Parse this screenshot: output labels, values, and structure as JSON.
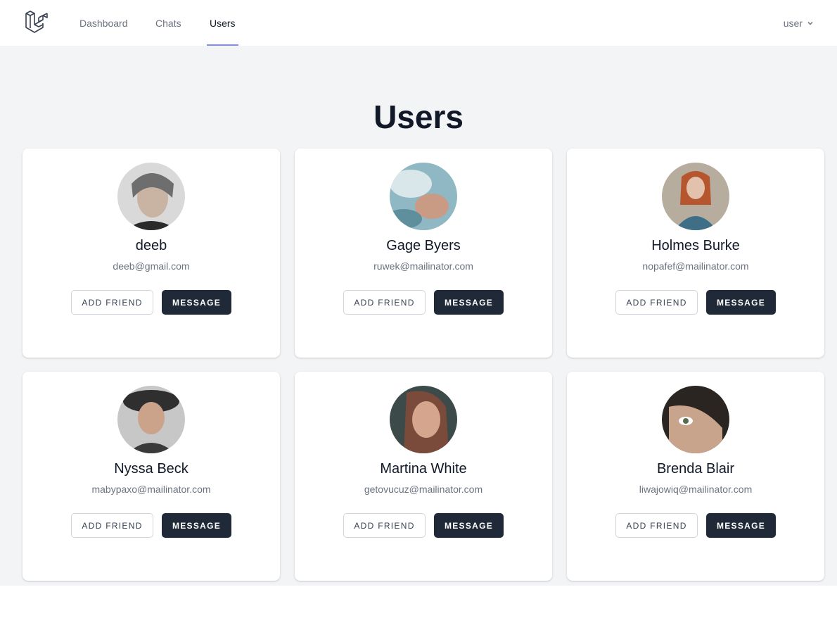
{
  "nav": {
    "links": [
      {
        "label": "Dashboard"
      },
      {
        "label": "Chats"
      },
      {
        "label": "Users",
        "active": true
      }
    ],
    "user_label": "user",
    "user_icon": "chevron-down-icon"
  },
  "page": {
    "title": "Users"
  },
  "users": [
    {
      "name": "deeb",
      "email": "deeb@gmail.com",
      "add_label": "ADD FRIEND",
      "message_label": "MESSAGE",
      "avatar_colors": [
        "#d9d9d9",
        "#6e6e6e",
        "#2a2a2a"
      ]
    },
    {
      "name": "Gage Byers",
      "email": "ruwek@mailinator.com",
      "add_label": "ADD FRIEND",
      "message_label": "MESSAGE",
      "avatar_colors": [
        "#8fb8c4",
        "#d9e6ea",
        "#c99a84"
      ]
    },
    {
      "name": "Holmes Burke",
      "email": "nopafef@mailinator.com",
      "add_label": "ADD FRIEND",
      "message_label": "MESSAGE",
      "avatar_colors": [
        "#b7ad9f",
        "#b5562f",
        "#3f6f86"
      ]
    },
    {
      "name": "Nyssa Beck",
      "email": "mabypaxo@mailinator.com",
      "add_label": "ADD FRIEND",
      "message_label": "MESSAGE",
      "avatar_colors": [
        "#c7c7c7",
        "#2f2f2f",
        "#caa38a"
      ]
    },
    {
      "name": "Martina White",
      "email": "getovucuz@mailinator.com",
      "add_label": "ADD FRIEND",
      "message_label": "MESSAGE",
      "avatar_colors": [
        "#3d4a4a",
        "#7a4a3a",
        "#d6a58e"
      ]
    },
    {
      "name": "Brenda Blair",
      "email": "liwajowiq@mailinator.com",
      "add_label": "ADD FRIEND",
      "message_label": "MESSAGE",
      "avatar_colors": [
        "#2a2520",
        "#c8a48c",
        "#5a6a4a"
      ]
    }
  ],
  "colors": {
    "accent_underline": "#818cf8",
    "message_button": "#1f2937",
    "background": "#f3f4f6"
  }
}
